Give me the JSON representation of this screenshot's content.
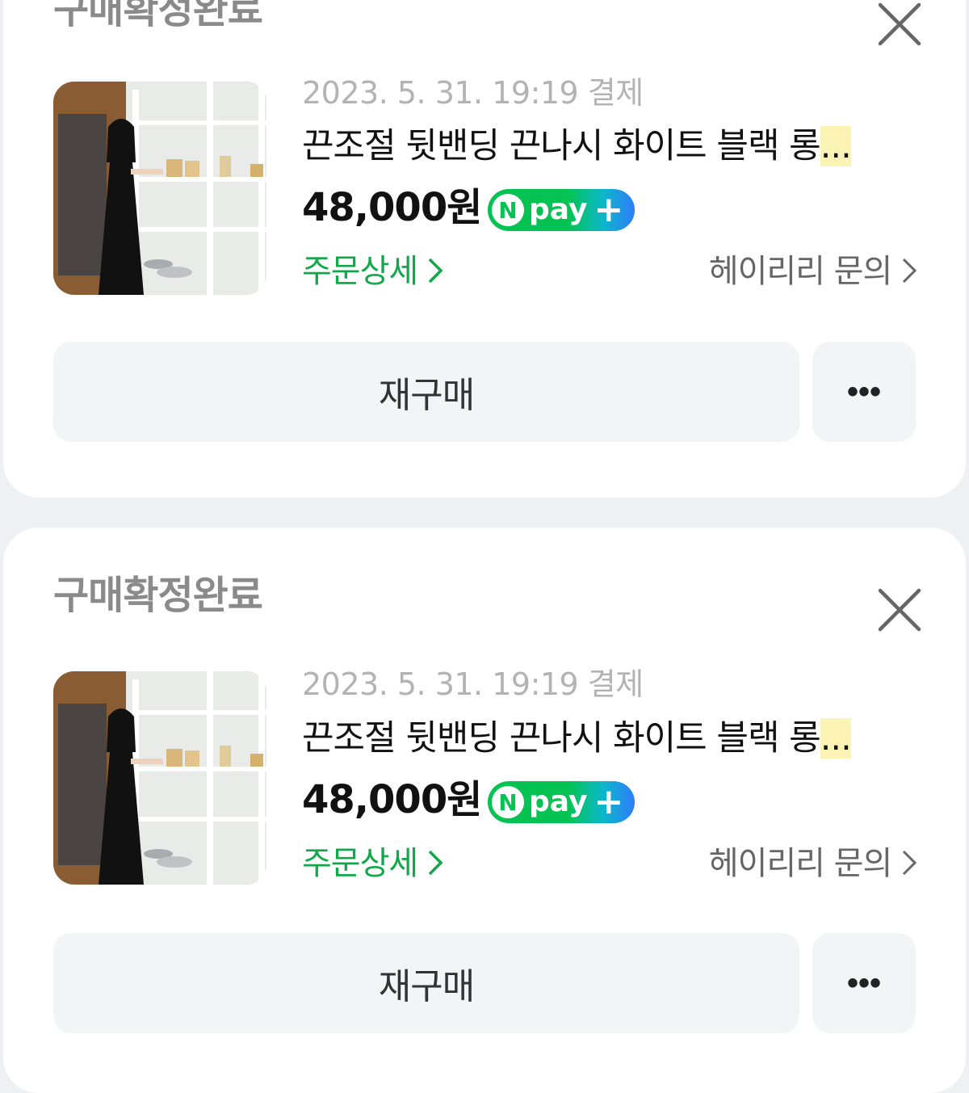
{
  "orders": [
    {
      "status": "구매확정완료",
      "meta": "2023. 5. 31. 19:19 결제",
      "title": "끈조절 뒷밴딩 끈나시 화이트 블랙 롱",
      "title_ellipsis": "...",
      "price": "48,000원",
      "npay": {
        "n": "N",
        "text": "pay",
        "plus": "+"
      },
      "order_detail": "주문상세",
      "inquiry": "헤이리리 문의",
      "rebuy": "재구매",
      "more": "•••"
    },
    {
      "status": "구매확정완료",
      "meta": "2023. 5. 31. 19:19 결제",
      "title": "끈조절 뒷밴딩 끈나시 화이트 블랙 롱",
      "title_ellipsis": "...",
      "price": "48,000원",
      "npay": {
        "n": "N",
        "text": "pay",
        "plus": "+"
      },
      "order_detail": "주문상세",
      "inquiry": "헤이리리 문의",
      "rebuy": "재구매",
      "more": "•••"
    }
  ],
  "colors": {
    "page_bg": "#eef0f4",
    "status": "#8a8a8a",
    "meta": "#b3b3b3",
    "accent_green": "#11a84a",
    "npay_green": "#05c353",
    "npay_blue": "#2f7dfa",
    "highlight": "#fbf3b3"
  },
  "icons": {
    "close": "close-icon",
    "chevron": "chevron-right-icon",
    "more": "more-icon"
  }
}
